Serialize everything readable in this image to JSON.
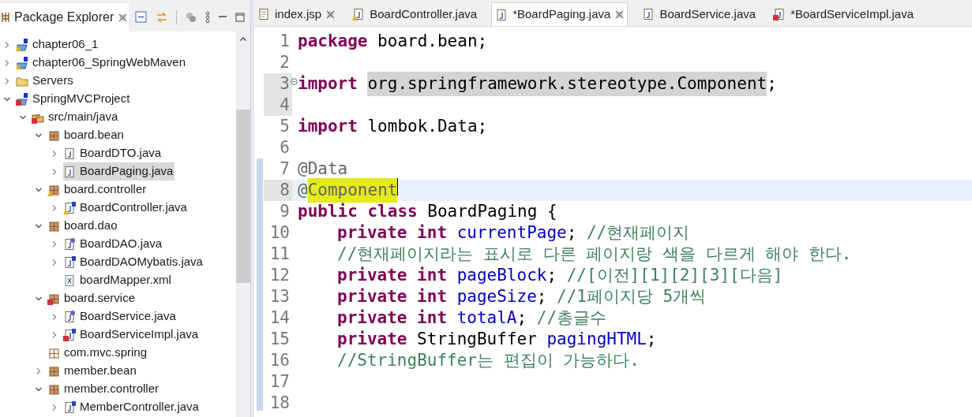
{
  "explorer": {
    "title": "Package Explorer",
    "tree": [
      {
        "label": "chapter06_1",
        "kind": "project",
        "error": false,
        "warning": true,
        "expanded": false,
        "selected": false
      },
      {
        "label": "chapter06_SpringWebMaven",
        "kind": "project",
        "error": false,
        "warning": true,
        "expanded": false,
        "selected": false
      },
      {
        "label": "Servers",
        "kind": "folder",
        "error": false,
        "warning": false,
        "expanded": false,
        "selected": false
      },
      {
        "label": "SpringMVCProject",
        "kind": "project",
        "error": true,
        "warning": false,
        "expanded": true,
        "selected": false,
        "children": [
          {
            "label": "src/main/java",
            "kind": "srcfolder",
            "error": true,
            "warning": false,
            "expanded": true,
            "selected": false,
            "children": [
              {
                "label": "board.bean",
                "kind": "package",
                "error": false,
                "warning": false,
                "expanded": true,
                "selected": false,
                "children": [
                  {
                    "label": "BoardDTO.java",
                    "kind": "java",
                    "error": false,
                    "warning": false,
                    "expanded": false,
                    "selected": false
                  },
                  {
                    "label": "BoardPaging.java",
                    "kind": "java",
                    "error": false,
                    "warning": false,
                    "expanded": false,
                    "selected": true
                  }
                ]
              },
              {
                "label": "board.controller",
                "kind": "package",
                "error": false,
                "warning": true,
                "expanded": true,
                "selected": false,
                "children": [
                  {
                    "label": "BoardController.java",
                    "kind": "java-s",
                    "error": false,
                    "warning": true,
                    "expanded": false,
                    "selected": false
                  }
                ]
              },
              {
                "label": "board.dao",
                "kind": "package",
                "error": false,
                "warning": false,
                "expanded": true,
                "selected": false,
                "children": [
                  {
                    "label": "BoardDAO.java",
                    "kind": "java-i",
                    "error": false,
                    "warning": false,
                    "expanded": false,
                    "selected": false
                  },
                  {
                    "label": "BoardDAOMybatis.java",
                    "kind": "java-s",
                    "error": false,
                    "warning": false,
                    "expanded": false,
                    "selected": false
                  },
                  {
                    "label": "boardMapper.xml",
                    "kind": "xml",
                    "error": false,
                    "warning": false,
                    "selected": false
                  }
                ]
              },
              {
                "label": "board.service",
                "kind": "package",
                "error": true,
                "warning": false,
                "expanded": true,
                "selected": false,
                "children": [
                  {
                    "label": "BoardService.java",
                    "kind": "java-i",
                    "error": false,
                    "warning": false,
                    "expanded": false,
                    "selected": false
                  },
                  {
                    "label": "BoardServiceImpl.java",
                    "kind": "java-s",
                    "error": true,
                    "warning": false,
                    "expanded": false,
                    "selected": false
                  }
                ]
              },
              {
                "label": "com.mvc.spring",
                "kind": "package-empty",
                "error": false,
                "warning": false,
                "selected": false
              },
              {
                "label": "member.bean",
                "kind": "package",
                "error": false,
                "warning": false,
                "expanded": false,
                "selected": false
              },
              {
                "label": "member.controller",
                "kind": "package",
                "error": false,
                "warning": false,
                "expanded": true,
                "selected": false,
                "children": [
                  {
                    "label": "MemberController.java",
                    "kind": "java-s",
                    "error": false,
                    "warning": false,
                    "expanded": false,
                    "selected": false
                  }
                ]
              }
            ]
          }
        ]
      }
    ]
  },
  "editor": {
    "tabs": [
      {
        "label": "index.jsp",
        "kind": "jsp",
        "error": false,
        "warning": false,
        "closable": true,
        "selected": false
      },
      {
        "label": "BoardController.java",
        "kind": "java",
        "error": false,
        "warning": true,
        "closable": false,
        "selected": false
      },
      {
        "label": "*BoardPaging.java",
        "kind": "java",
        "error": false,
        "warning": false,
        "closable": true,
        "selected": true
      },
      {
        "label": "BoardService.java",
        "kind": "java",
        "error": false,
        "warning": false,
        "closable": false,
        "selected": false
      },
      {
        "label": "*BoardServiceImpl.java",
        "kind": "java",
        "error": true,
        "warning": false,
        "closable": false,
        "selected": false
      }
    ],
    "lines": [
      {
        "number": "1",
        "current": false,
        "fold": false,
        "indented": false,
        "tokens": [
          {
            "kind": "kw",
            "text": "package"
          },
          {
            "kind": "plain",
            "text": "board.bean;",
            "gap": true
          }
        ]
      },
      {
        "number": "2",
        "current": false,
        "fold": false
      },
      {
        "number": "3",
        "current": false,
        "fold": true,
        "indented": false,
        "tokens": [
          {
            "kind": "kw",
            "text": "import"
          },
          {
            "kind": "mark",
            "text": "org.springframework.stereotype.Component",
            "gap": true
          },
          {
            "kind": "plain",
            "text": ";"
          }
        ]
      },
      {
        "number": "4",
        "current": false,
        "fold": false
      },
      {
        "number": "5",
        "current": false,
        "fold": false,
        "indented": false,
        "tokens": [
          {
            "kind": "kw",
            "text": "import"
          },
          {
            "kind": "plain",
            "text": "lombok.Data;",
            "gap": true
          }
        ]
      },
      {
        "number": "6",
        "current": false,
        "fold": false
      },
      {
        "number": "7",
        "current": false,
        "fold": false,
        "indented": false,
        "tokens": [
          {
            "kind": "annotation",
            "text": "@Data"
          }
        ]
      },
      {
        "number": "8",
        "current": true,
        "fold": false,
        "indented": false,
        "tokens": [
          {
            "kind": "annotation",
            "text": "@"
          },
          {
            "kind": "hit",
            "text": "Component"
          }
        ]
      },
      {
        "number": "9",
        "current": false,
        "fold": false,
        "indented": false,
        "tokens": [
          {
            "kind": "kw",
            "text": "public"
          },
          {
            "kind": "kw",
            "text": "class",
            "gap": true
          },
          {
            "kind": "plain",
            "text": "BoardPaging {",
            "gap": true
          }
        ]
      },
      {
        "number": "10",
        "current": false,
        "fold": false,
        "indented": true,
        "tokens": [
          {
            "kind": "kw",
            "text": "private"
          },
          {
            "kind": "kw",
            "text": "int",
            "gap": true
          },
          {
            "kind": "field",
            "text": "currentPage",
            "gap": true
          },
          {
            "kind": "plain",
            "text": ";"
          },
          {
            "kind": "comment",
            "text": "//현재페이지",
            "gap": true
          }
        ]
      },
      {
        "number": "11",
        "current": false,
        "fold": false,
        "indented": true,
        "tokens": [
          {
            "kind": "comment",
            "text": "//현재페이지라는 표시로 다른 페이지랑 색을 다르게 해야 한다."
          }
        ]
      },
      {
        "number": "12",
        "current": false,
        "fold": false,
        "indented": true,
        "tokens": [
          {
            "kind": "kw",
            "text": "private"
          },
          {
            "kind": "kw",
            "text": "int",
            "gap": true
          },
          {
            "kind": "field",
            "text": "pageBlock",
            "gap": true
          },
          {
            "kind": "plain",
            "text": ";"
          },
          {
            "kind": "comment",
            "text": "//[이전][1][2][3][다음]",
            "gap": true
          }
        ]
      },
      {
        "number": "13",
        "current": false,
        "fold": false,
        "indented": true,
        "tokens": [
          {
            "kind": "kw",
            "text": "private"
          },
          {
            "kind": "kw",
            "text": "int",
            "gap": true
          },
          {
            "kind": "field",
            "text": "pageSize",
            "gap": true
          },
          {
            "kind": "plain",
            "text": ";"
          },
          {
            "kind": "comment",
            "text": "//1페이지당 5개씩",
            "gap": true
          }
        ]
      },
      {
        "number": "14",
        "current": false,
        "fold": false,
        "indented": true,
        "tokens": [
          {
            "kind": "kw",
            "text": "private"
          },
          {
            "kind": "kw",
            "text": "int",
            "gap": true
          },
          {
            "kind": "field",
            "text": "totalA",
            "gap": true
          },
          {
            "kind": "plain",
            "text": ";"
          },
          {
            "kind": "comment",
            "text": "//총글수",
            "gap": true
          }
        ]
      },
      {
        "number": "15",
        "current": false,
        "fold": false,
        "indented": true,
        "tokens": [
          {
            "kind": "kw",
            "text": "private"
          },
          {
            "kind": "plain",
            "text": "StringBuffer",
            "gap": true
          },
          {
            "kind": "field",
            "text": "pagingHTML",
            "gap": true
          },
          {
            "kind": "plain",
            "text": ";"
          }
        ]
      },
      {
        "number": "16",
        "current": false,
        "fold": false,
        "indented": true,
        "tokens": [
          {
            "kind": "comment",
            "text": "//StringBuffer는 편집이 가능하다."
          }
        ]
      },
      {
        "number": "17",
        "current": false,
        "fold": false
      },
      {
        "number": "18",
        "current": false,
        "fold": false
      }
    ]
  }
}
